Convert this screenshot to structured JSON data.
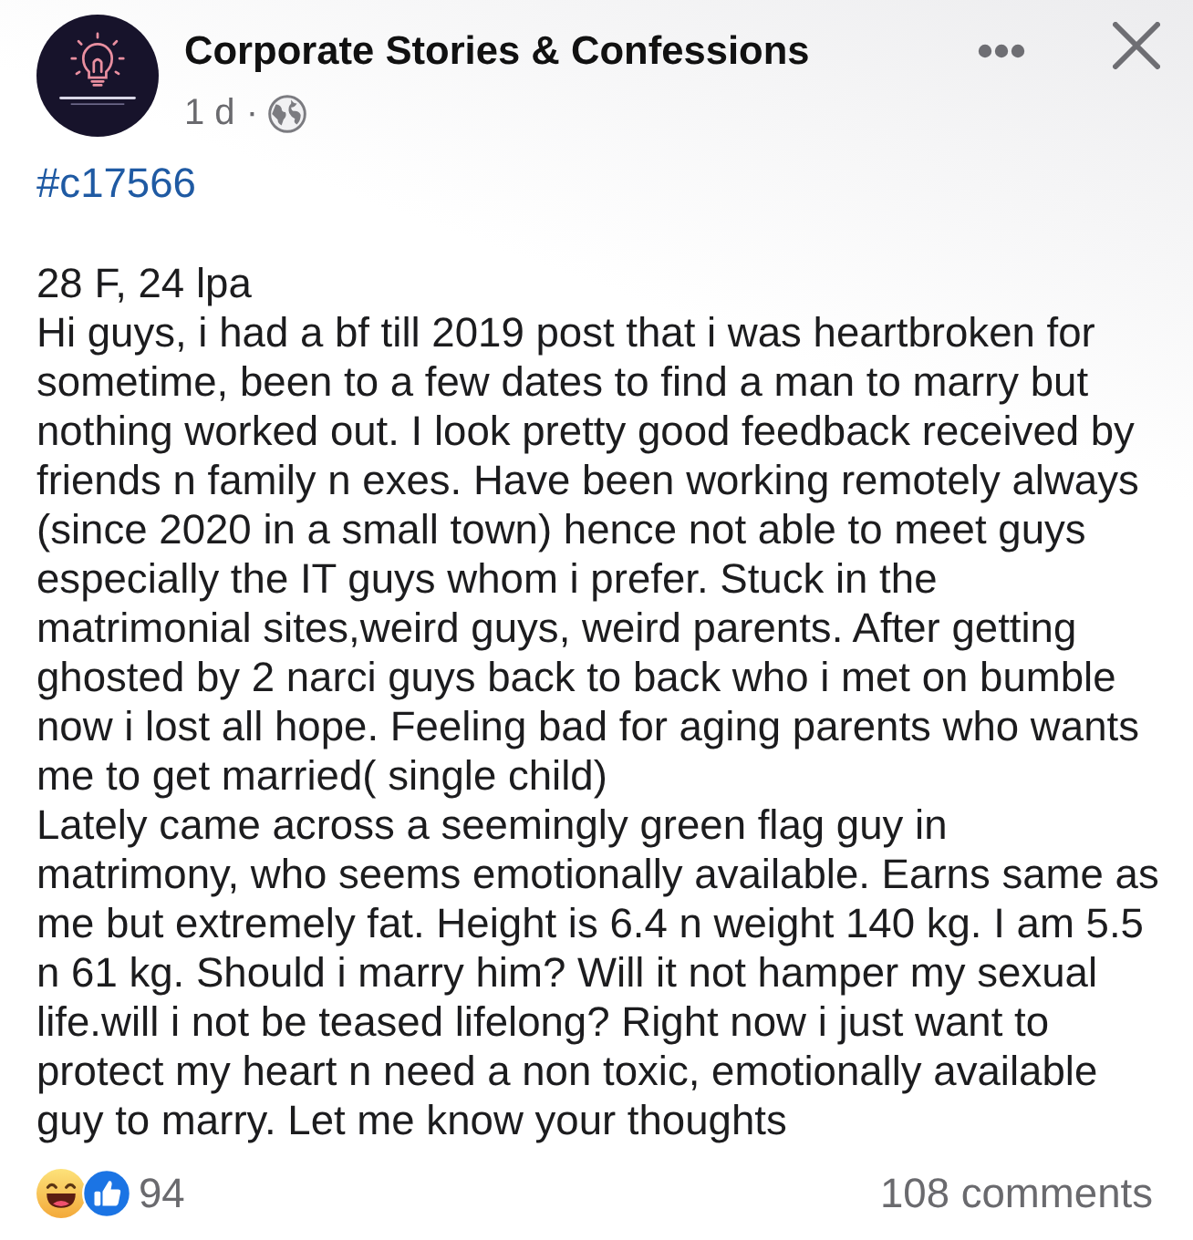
{
  "post": {
    "page_name": "Corporate Stories & Confessions",
    "time": "1 d",
    "separator": "·",
    "hashtag": "#c17566",
    "paragraphs": [
      "28 F, 24 lpa",
      "Hi guys, i had a bf till 2019 post that i was heartbroken for sometime, been to a few dates to find a man to marry but nothing worked out. I look pretty good feedback received by friends n family n exes. Have been working remotely always (since 2020 in a small town) hence not able to meet guys especially the IT guys whom i prefer. Stuck in the matrimonial sites,weird guys, weird parents. After getting ghosted by 2 narci guys back to back who i met on bumble now i lost all hope. Feeling bad for aging parents who wants me to get married( single child)",
      "Lately came across a seemingly green flag guy in matrimony, who seems emotionally available. Earns same as me but extremely fat. Height is 6.4 n weight 140 kg. I am 5.5 n 61 kg. Should i marry him? Will it not hamper my sexual life.will i not be teased lifelong? Right now i just want to protect my heart n need a non toxic, emotionally available guy to marry. Let me know your thoughts"
    ]
  },
  "footer": {
    "reaction_count": "94",
    "comments": "108 comments"
  }
}
